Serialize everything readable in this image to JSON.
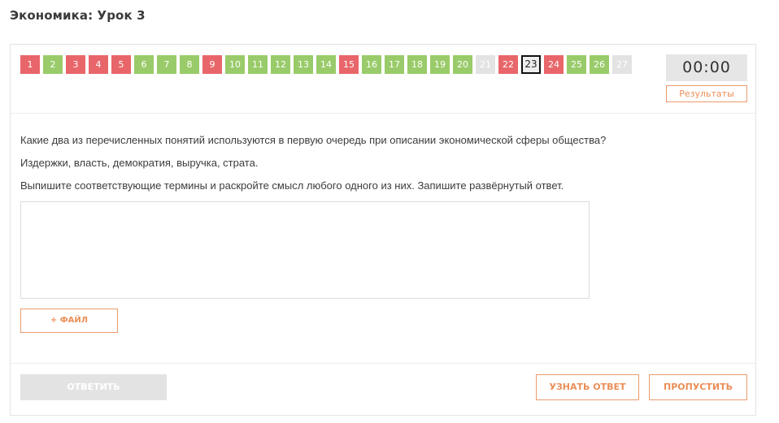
{
  "page": {
    "title": "Экономика: Урок 3"
  },
  "navigation": {
    "questions": [
      {
        "label": "1",
        "status": "wrong"
      },
      {
        "label": "2",
        "status": "correct"
      },
      {
        "label": "3",
        "status": "wrong"
      },
      {
        "label": "4",
        "status": "wrong"
      },
      {
        "label": "5",
        "status": "wrong"
      },
      {
        "label": "6",
        "status": "correct"
      },
      {
        "label": "7",
        "status": "correct"
      },
      {
        "label": "8",
        "status": "correct"
      },
      {
        "label": "9",
        "status": "wrong"
      },
      {
        "label": "10",
        "status": "correct"
      },
      {
        "label": "11",
        "status": "correct"
      },
      {
        "label": "12",
        "status": "correct"
      },
      {
        "label": "13",
        "status": "correct"
      },
      {
        "label": "14",
        "status": "correct"
      },
      {
        "label": "15",
        "status": "wrong"
      },
      {
        "label": "16",
        "status": "correct"
      },
      {
        "label": "17",
        "status": "correct"
      },
      {
        "label": "18",
        "status": "correct"
      },
      {
        "label": "19",
        "status": "correct"
      },
      {
        "label": "20",
        "status": "correct"
      },
      {
        "label": "21",
        "status": "unanswered"
      },
      {
        "label": "22",
        "status": "wrong"
      },
      {
        "label": "23",
        "status": "current"
      },
      {
        "label": "24",
        "status": "wrong"
      },
      {
        "label": "25",
        "status": "correct"
      },
      {
        "label": "26",
        "status": "correct"
      },
      {
        "label": "27",
        "status": "unanswered"
      }
    ]
  },
  "timer": {
    "value": "00:00"
  },
  "results_button": {
    "label": "Результаты"
  },
  "question": {
    "prompt": "Какие два из перечисленных понятий используются в первую очередь при описании экономической сферы общества?",
    "options": "Издержки, власть, демократия, выручка, страта.",
    "instruction": "Выпишите соответствующие термины и раскройте смысл любого одного из них. Запишите развёрнутый ответ."
  },
  "answer": {
    "value": ""
  },
  "file_button": {
    "label": "+ ФАЙЛ"
  },
  "footer": {
    "answer_label": "ОТВЕТИТЬ",
    "reveal_label": "УЗНАТЬ ОТВЕТ",
    "skip_label": "ПРОПУСТИТЬ"
  },
  "colors": {
    "wrong": "#e8666a",
    "correct": "#9acb6a",
    "unanswered": "#e3e3e3",
    "accent": "#eb8e57"
  }
}
